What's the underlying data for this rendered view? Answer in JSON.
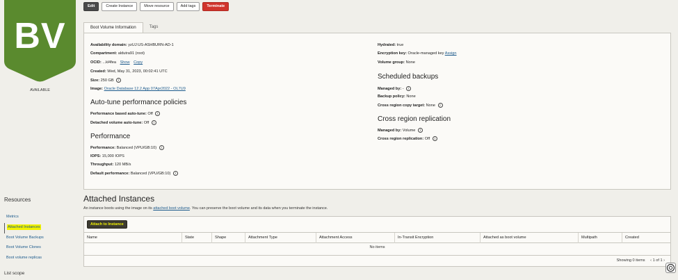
{
  "volume": {
    "badge": "BV",
    "status": "AVAILABLE",
    "badge_color": "#5a8a2e"
  },
  "toolbar": {
    "edit": "Edit",
    "create_instance": "Create Instance",
    "move_resource": "Move resource",
    "add_tags": "Add tags",
    "terminate": "Terminate"
  },
  "tabs": [
    {
      "label": "Boot Volume Information",
      "active": true
    },
    {
      "label": "Tags",
      "active": false
    }
  ],
  "info": {
    "availability_domain_label": "Availability domain:",
    "availability_domain": "yzUJ:US-ASHBURN-AD-1",
    "compartment_label": "Compartment:",
    "compartment": "aldutra91 (root)",
    "ocid_label": "OCID:",
    "ocid": "...kl4fea",
    "ocid_show": "Show",
    "ocid_copy": "Copy",
    "created_label": "Created:",
    "created": "Wed, May 31, 2023, 00:02:41 UTC",
    "size_label": "Size:",
    "size": "250 GB",
    "image_label": "Image:",
    "image": "Oracle Database 12.2 App 07Apr2022 - OL7U9",
    "hydrated_label": "Hydrated:",
    "hydrated": "true",
    "encryption_label": "Encryption key:",
    "encryption": "Oracle-managed key",
    "encryption_assign": "Assign",
    "volume_group_label": "Volume group:",
    "volume_group": "None"
  },
  "autotune": {
    "title": "Auto-tune performance policies",
    "perf_based_label": "Performance based auto-tune:",
    "perf_based": "Off",
    "detached_label": "Detached volume auto-tune:",
    "detached": "Off"
  },
  "performance": {
    "title": "Performance",
    "performance_label": "Performance:",
    "performance": "Balanced (VPU/GB:10)",
    "iops_label": "IOPS:",
    "iops": "15,000 IOPS",
    "throughput_label": "Throughput:",
    "throughput": "120 MB/s",
    "default_label": "Default performance:",
    "default": "Balanced (VPU/GB:10)"
  },
  "scheduled": {
    "title": "Scheduled backups",
    "managed_by_label": "Managed by:",
    "managed_by": "-",
    "backup_policy_label": "Backup policy:",
    "backup_policy": "None",
    "cross_copy_label": "Cross region copy target:",
    "cross_copy": "None"
  },
  "replication": {
    "title": "Cross region replication",
    "managed_by_label": "Managed by:",
    "managed_by": "Volume",
    "replication_label": "Cross region replication:",
    "replication": "Off"
  },
  "resources": {
    "title": "Resources",
    "items": [
      {
        "label": "Metrics",
        "active": false
      },
      {
        "label": "Attached Instances",
        "active": true
      },
      {
        "label": "Boot Volume Backups",
        "active": false
      },
      {
        "label": "Boot Volume Clones",
        "active": false
      },
      {
        "label": "Boot volume replicas",
        "active": false
      }
    ],
    "list_scope": "List scope"
  },
  "attached": {
    "title": "Attached Instances",
    "desc_prefix": "An instance boots using the image on its",
    "desc_link": "attached boot volume",
    "desc_suffix": ". You can preserve the boot volume and its data when you terminate the instance.",
    "attach_button": "Attach to Instance",
    "columns": [
      "Name",
      "State",
      "Shape",
      "Attachment Type",
      "Attachment Access",
      "In-Transit Encryption",
      "Attached as boot volume",
      "Multipath",
      "Created"
    ],
    "empty": "No items",
    "showing": "Showing 0 items",
    "pager": "1 of 1"
  }
}
